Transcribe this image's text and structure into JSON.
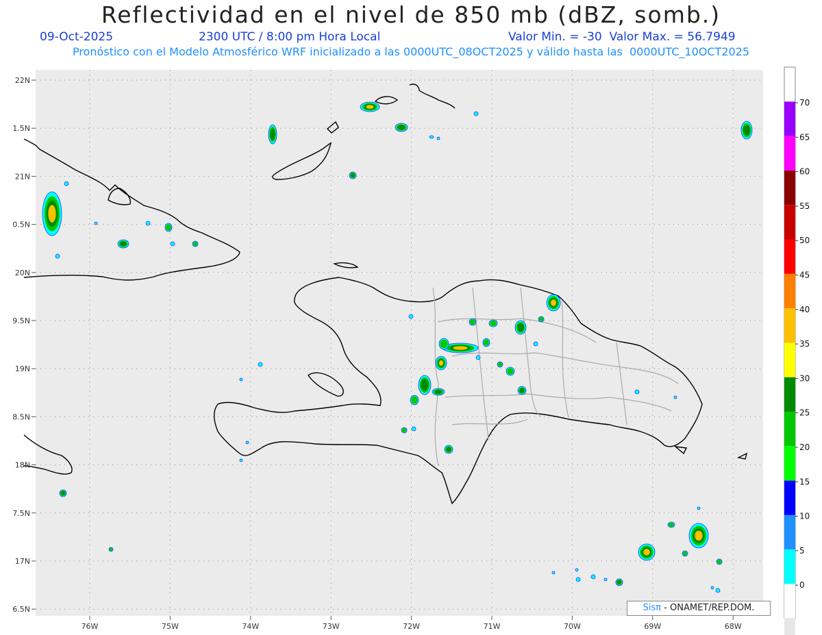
{
  "header": {
    "title": "Reflectividad en el nivel de 850 mb (dBZ, somb.)",
    "date": "09-Oct-2025",
    "time": "2300 UTC / 8:00 pm Hora Local",
    "minmax": "Valor Min. = -30  Valor Max. = 56.7949",
    "description": "Pronóstico con el Modelo Atmosférico WRF inicializado a las 0000UTC_08OCT2025 y válido hasta las  0000UTC_10OCT2025"
  },
  "map": {
    "lat_labels": [
      "22N",
      "1.5N",
      "21N",
      "0.5N",
      "20N",
      "9.5N",
      "19N",
      "8.5N",
      "18N",
      "7.5N",
      "17N",
      "6.5N"
    ],
    "lon_labels": [
      "76W",
      "75W",
      "74W",
      "73W",
      "72W",
      "71W",
      "70W",
      "69W",
      "68W"
    ],
    "background_color": "#ebebeb",
    "coast_color": "#000000",
    "province_color": "#aaaaaa"
  },
  "colorbar": {
    "labels": [
      "70",
      "65",
      "60",
      "55",
      "50",
      "45",
      "40",
      "35",
      "30",
      "25",
      "20",
      "15",
      "10",
      "5",
      "0"
    ],
    "colors": [
      "#9a00ff",
      "#ff00ff",
      "#8b0000",
      "#c80000",
      "#ff0000",
      "#ff7f00",
      "#ffc000",
      "#ffff00",
      "#008a00",
      "#00c800",
      "#00ff00",
      "#0000ff",
      "#1e90ff",
      "#00ffff",
      "#ffffff",
      "#e6e6e6"
    ]
  },
  "credit": {
    "sis": "Sisπ",
    "text": " - ONAMET/REP.DOM."
  }
}
